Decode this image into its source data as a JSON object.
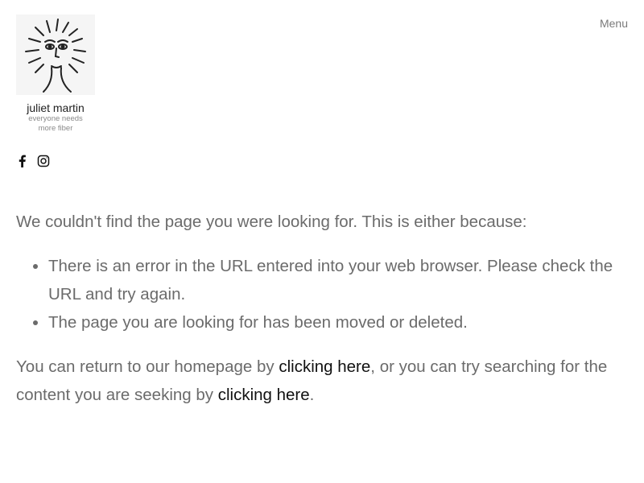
{
  "header": {
    "logo": {
      "name": "juliet martin",
      "tagline_line1": "everyone needs",
      "tagline_line2": "more fiber"
    },
    "menu_label": "Menu",
    "social": {
      "facebook_icon": "facebook-icon",
      "instagram_icon": "instagram-icon"
    }
  },
  "main": {
    "intro": "We couldn't find the page you were looking for. This is either because:",
    "reasons": [
      "There is an error in the URL entered into your web browser. Please check the URL and try again.",
      "The page you are looking for has been moved or deleted."
    ],
    "return": {
      "before_link1": "You can return to our homepage by ",
      "link1": "clicking here",
      "between": ", or you can try searching for the content you are seeking by ",
      "link2": "clicking here",
      "after": "."
    }
  }
}
